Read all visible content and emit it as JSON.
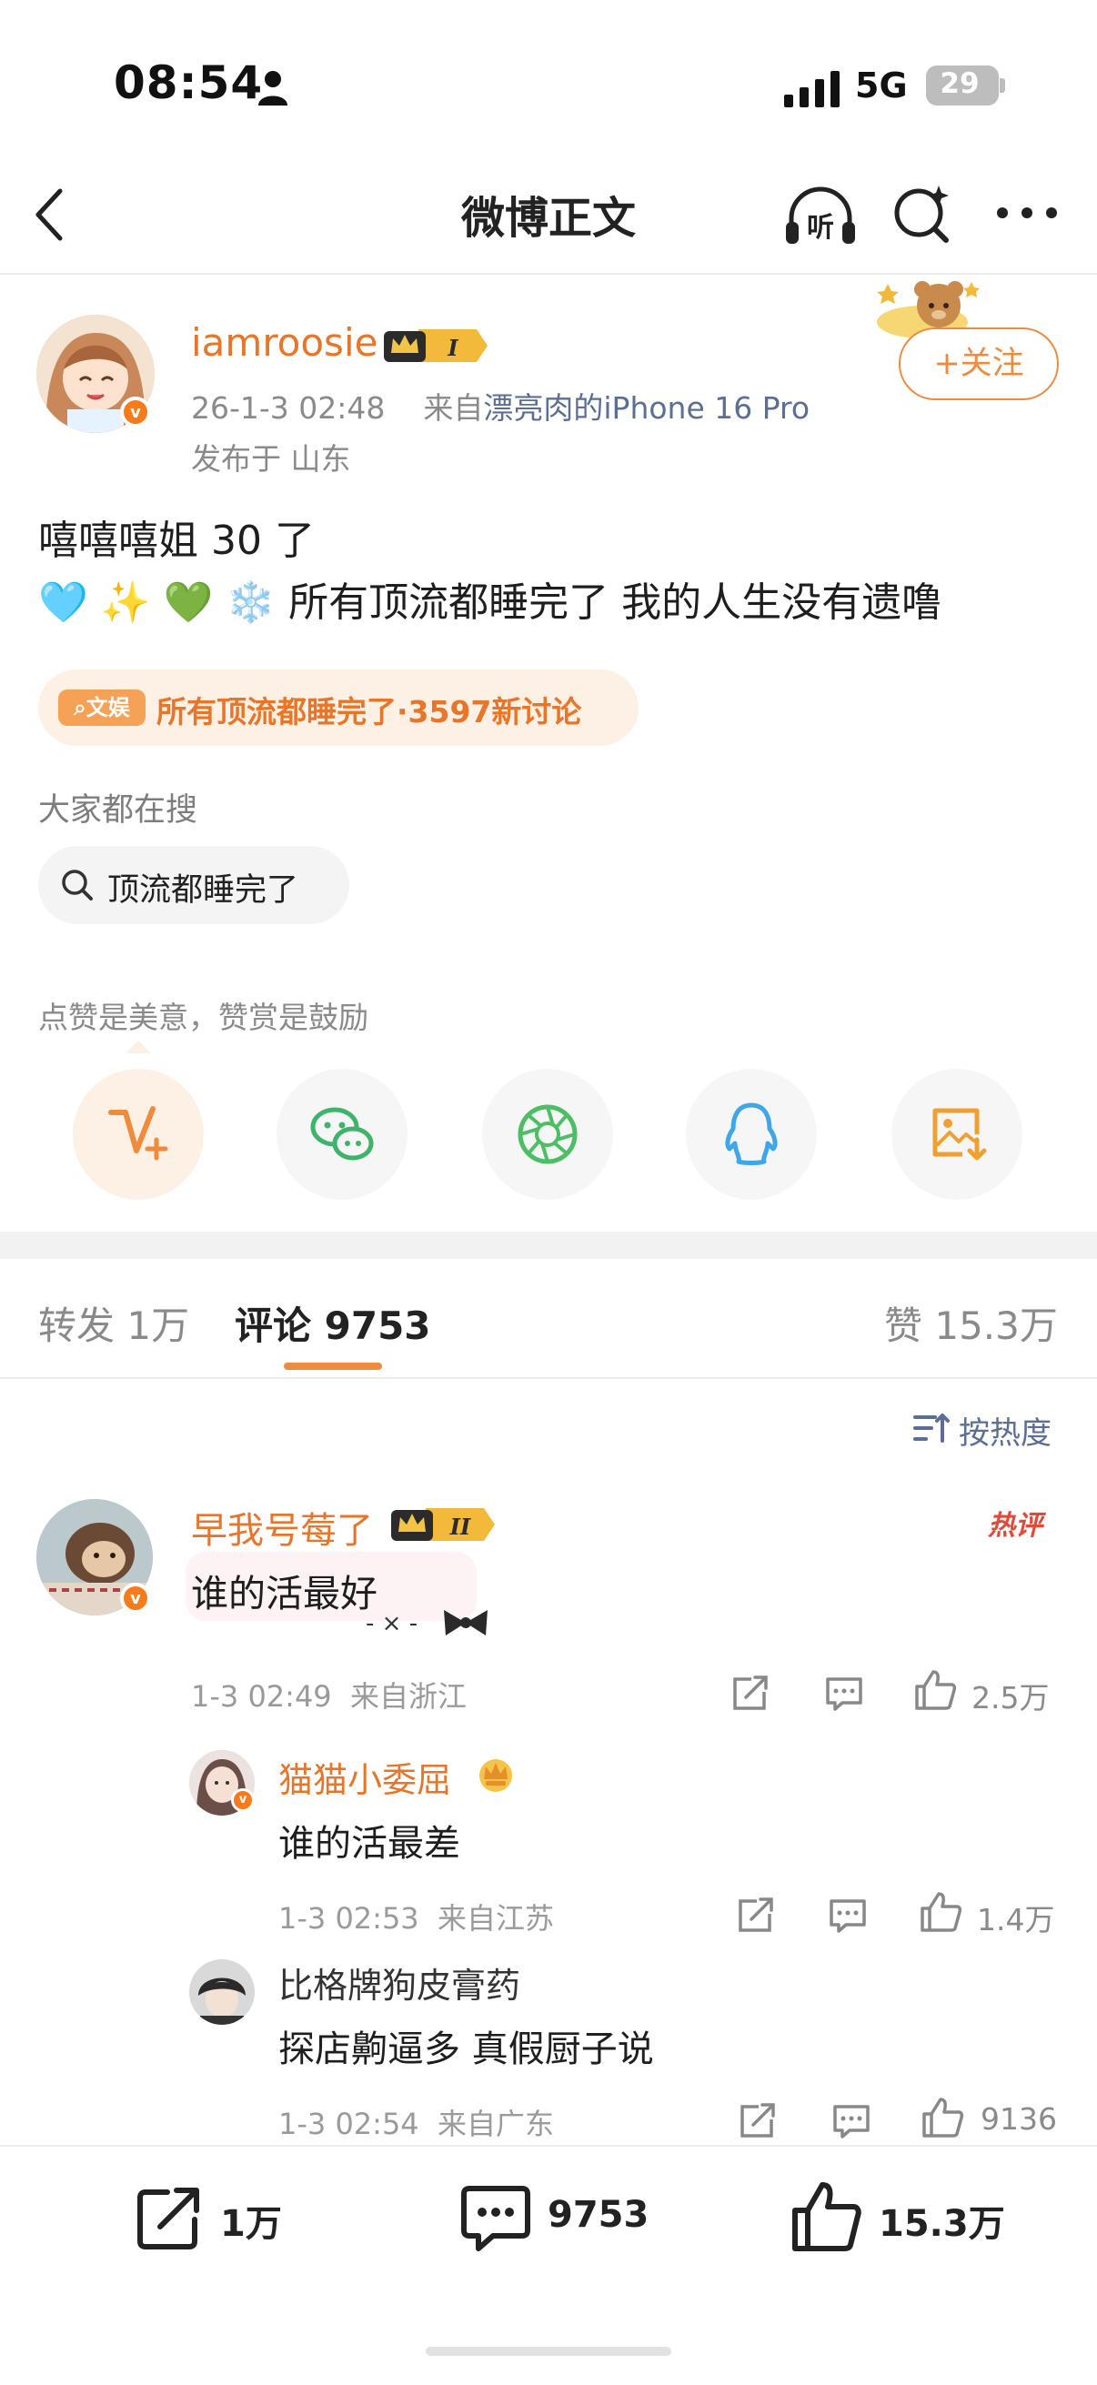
{
  "status_bar": {
    "time": "08:54",
    "network": "5G",
    "battery": "29"
  },
  "nav": {
    "title": "微博正文"
  },
  "post": {
    "username": "iamroosie",
    "badge_level": "I",
    "time": "26-1-3 02:48",
    "source_prefix": "来自",
    "device": "漂亮肉的iPhone 16 Pro",
    "location": "发布于 山东",
    "follow_label": "+关注",
    "line1": "嘻嘻嘻姐 30 了",
    "line2_emojis": "🩵 ✨ 💚 ❄️",
    "line2_text": "所有顶流都睡完了 我的人生没有遗噜",
    "topic_tag": "文娱",
    "topic_text": "所有顶流都睡完了·3597新讨论",
    "search_label": "大家都在搜",
    "search_chip": "顶流都睡完了",
    "like_hint": "点赞是美意，赞赏是鼓励"
  },
  "share_actions": [
    {
      "name": "reward",
      "icon": "reward-v-plus-icon"
    },
    {
      "name": "wechat",
      "icon": "wechat-icon"
    },
    {
      "name": "moments",
      "icon": "moments-icon"
    },
    {
      "name": "qq",
      "icon": "qq-icon"
    },
    {
      "name": "save-image",
      "icon": "save-image-icon"
    }
  ],
  "tabs": {
    "repost": "转发 1万",
    "comments": "评论 9753",
    "likes": "赞 15.3万",
    "sort": "按热度"
  },
  "comments": [
    {
      "username": "早我号莓了",
      "badge_level": "II",
      "text": "谁的活最好",
      "deco": "- × - ",
      "time": "1-3 02:49",
      "location": "来自浙江",
      "likes": "2.5万",
      "hot_badge": "热评"
    }
  ],
  "replies": [
    {
      "username": "猫猫小委屈",
      "text": "谁的活最差",
      "time": "1-3 02:53",
      "location": "来自江苏",
      "likes": "1.4万"
    },
    {
      "username": "比格牌狗皮膏药",
      "text": "探店齁逼多 真假厨子说",
      "time": "1-3 02:54",
      "location": "来自广东",
      "likes": "9136"
    }
  ],
  "bottom_bar": {
    "repost_count": "1万",
    "comment_count": "9753",
    "like_count": "15.3万"
  },
  "colors": {
    "accent": "#f08a3c",
    "username": "#e8762a",
    "link": "#5b6f95"
  }
}
